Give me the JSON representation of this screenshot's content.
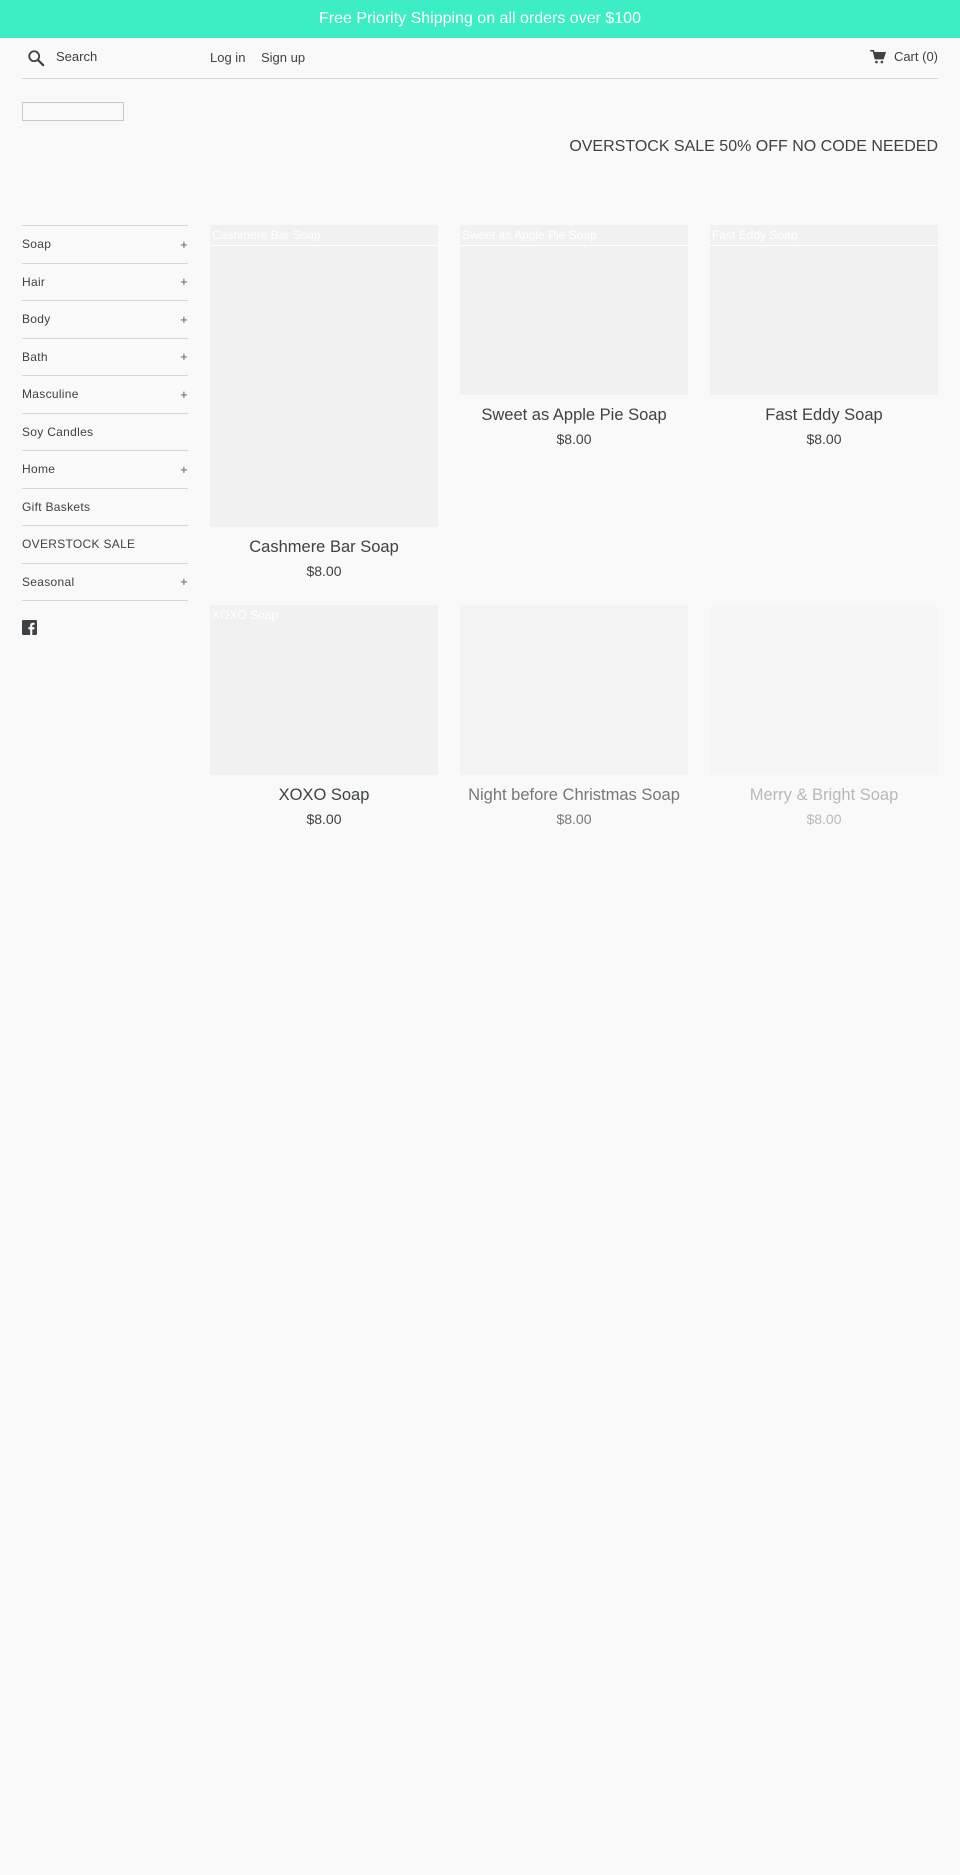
{
  "announcement": "Free Priority Shipping on all orders over $100",
  "header": {
    "search_placeholder": "Search",
    "login": "Log in",
    "signup": "Sign up",
    "cart": "Cart (0)"
  },
  "promo": "OVERSTOCK SALE 50% OFF NO CODE NEEDED",
  "sidebar": {
    "items": [
      {
        "label": "Soap",
        "toggle": "+"
      },
      {
        "label": "Hair",
        "toggle": "+"
      },
      {
        "label": "Body",
        "toggle": "+"
      },
      {
        "label": "Bath",
        "toggle": "+"
      },
      {
        "label": "Masculine",
        "toggle": "+"
      },
      {
        "label": "Soy Candles",
        "toggle": ""
      },
      {
        "label": "Home",
        "toggle": "+"
      },
      {
        "label": "Gift Baskets",
        "toggle": ""
      },
      {
        "label": "OVERSTOCK SALE",
        "toggle": ""
      },
      {
        "label": "Seasonal",
        "toggle": "+"
      }
    ]
  },
  "products": [
    {
      "title": "Cashmere Bar Soap",
      "price": "$8.00",
      "alt": "Cashmere Bar Soap"
    },
    {
      "title": "Sweet as Apple Pie Soap",
      "price": "$8.00",
      "alt": "Sweet as Apple Pie Soap"
    },
    {
      "title": "Fast Eddy Soap",
      "price": "$8.00",
      "alt": "Fast Eddy Soap"
    },
    {
      "title": "XOXO Soap",
      "price": "$8.00",
      "alt": "XOXO Soap"
    },
    {
      "title": "Night before Christmas Soap",
      "price": "$8.00",
      "alt": ""
    },
    {
      "title": "Merry & Bright Soap",
      "price": "$8.00",
      "alt": ""
    }
  ]
}
